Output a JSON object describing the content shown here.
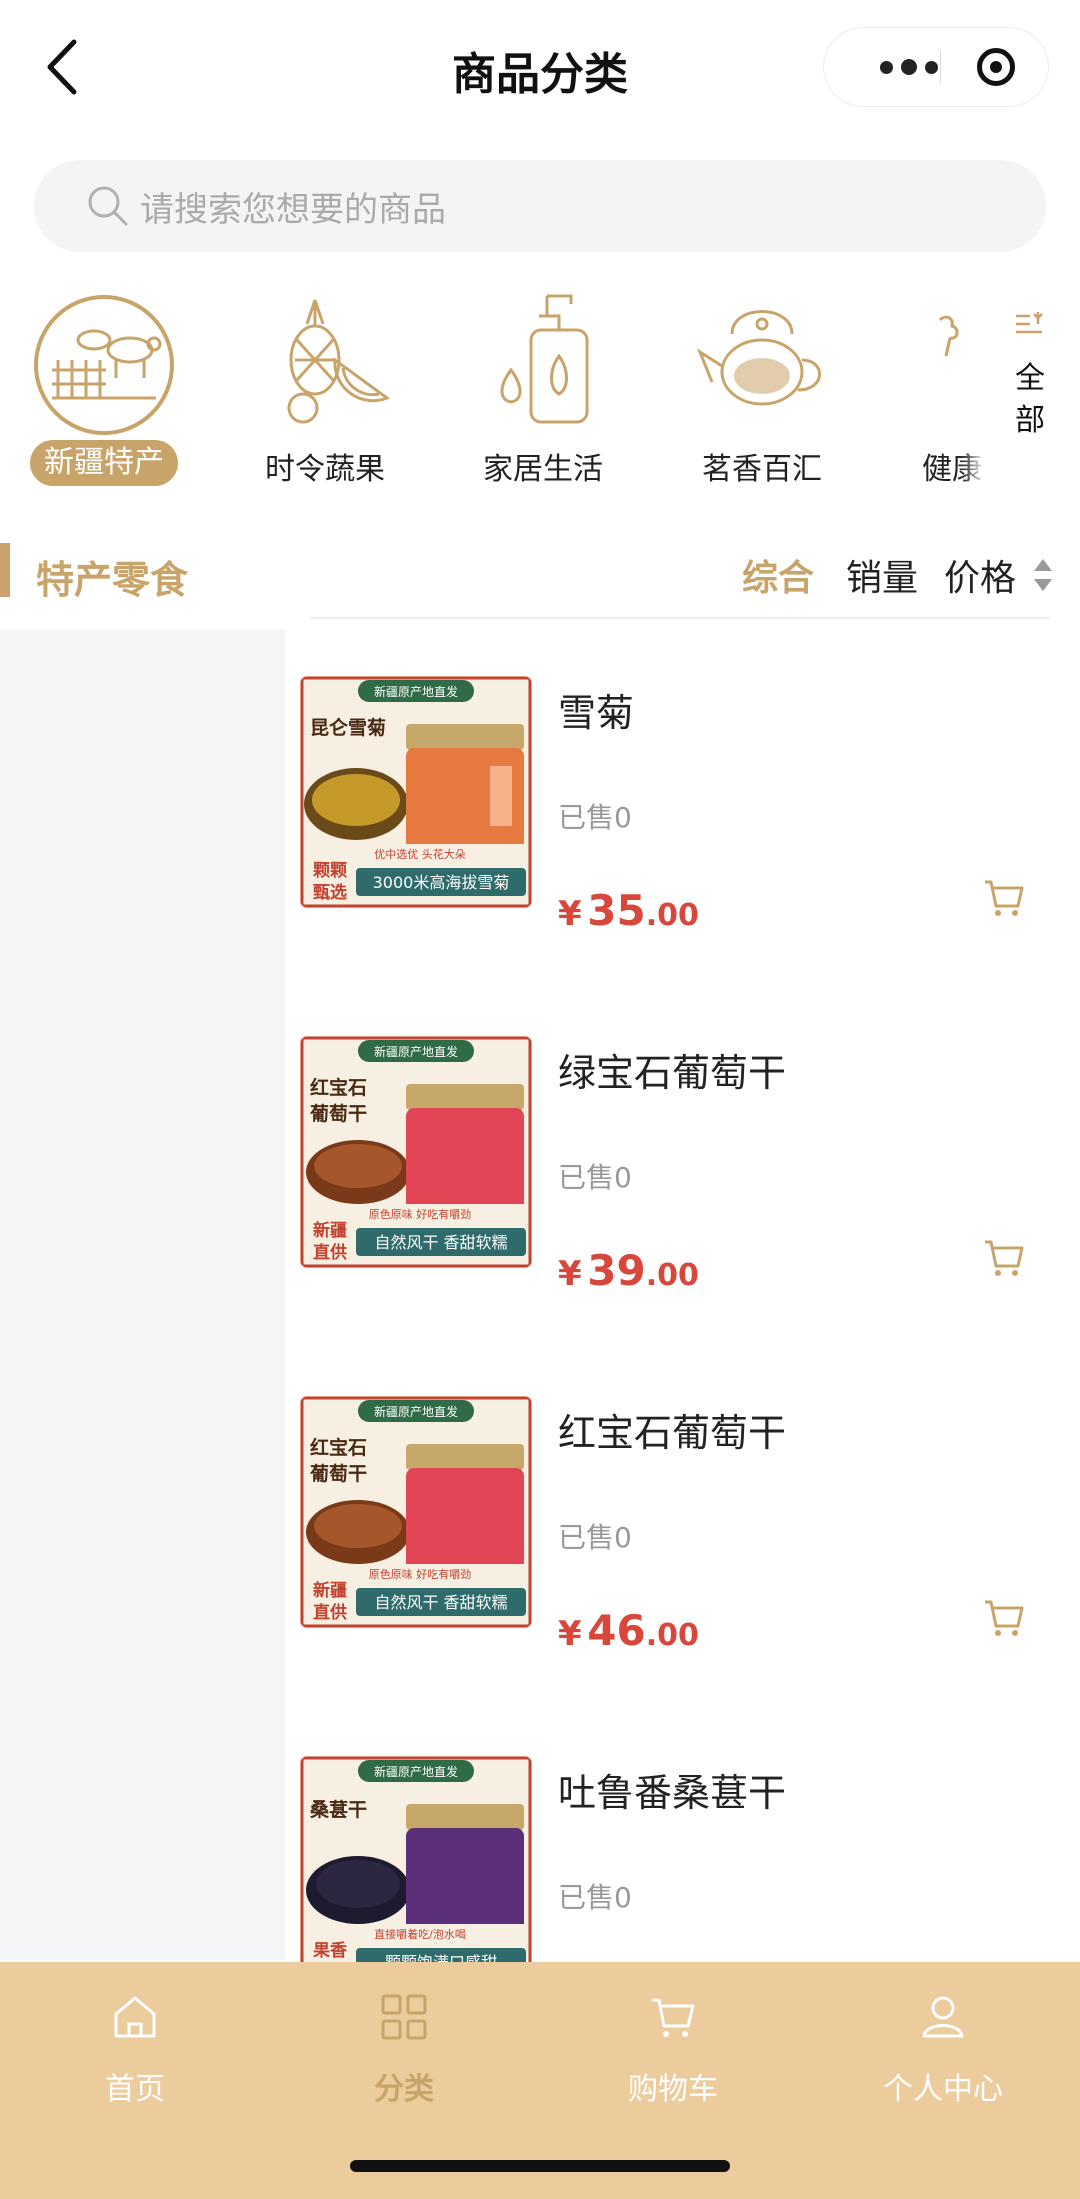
{
  "header": {
    "title": "商品分类"
  },
  "search": {
    "placeholder": "请搜索您想要的商品"
  },
  "categories": [
    {
      "label": "新疆特产",
      "icon": "farm-icon",
      "active": true
    },
    {
      "label": "时令蔬果",
      "icon": "fruit-icon",
      "active": false
    },
    {
      "label": "家居生活",
      "icon": "soap-bottle-icon",
      "active": false
    },
    {
      "label": "茗香百汇",
      "icon": "teapot-icon",
      "active": false
    },
    {
      "label": "健康",
      "icon": "health-icon",
      "active": false
    }
  ],
  "all_button": {
    "label": "全部"
  },
  "subcategory": {
    "title": "特产零食"
  },
  "sort": {
    "comprehensive": "综合",
    "sales": "销量",
    "price": "价格"
  },
  "products": [
    {
      "name": "雪菊",
      "sold": "已售0",
      "currency": "¥",
      "price_int": "35",
      "price_dec": ".00",
      "image": {
        "badge": "新疆原产地直发",
        "label": "昆仑雪菊",
        "corner": "颗颗甄选",
        "tagline": "3000米高海拔雪菊",
        "small": "优中选优 头花大朵"
      }
    },
    {
      "name": "绿宝石葡萄干",
      "sold": "已售0",
      "currency": "¥",
      "price_int": "39",
      "price_dec": ".00",
      "image": {
        "badge": "新疆原产地直发",
        "label": "红宝石葡萄干",
        "corner": "新疆直供",
        "tagline": "自然风干 香甜软糯",
        "small": "原色原味 好吃有嚼劲"
      }
    },
    {
      "name": "红宝石葡萄干",
      "sold": "已售0",
      "currency": "¥",
      "price_int": "46",
      "price_dec": ".00",
      "image": {
        "badge": "新疆原产地直发",
        "label": "红宝石葡萄干",
        "corner": "新疆直供",
        "tagline": "自然风干 香甜软糯",
        "small": "原色原味 好吃有嚼劲"
      }
    },
    {
      "name": "吐鲁番桑葚干",
      "sold": "已售0",
      "image": {
        "badge": "新疆原产地直发",
        "label": "桑葚干",
        "corner": "果香",
        "tagline": "颗颗饱满口感甜",
        "small": "直接嚼着吃/泡水喝"
      }
    }
  ],
  "tabbar": [
    {
      "label": "首页",
      "icon": "home-icon",
      "active": false
    },
    {
      "label": "分类",
      "icon": "grid-icon",
      "active": true
    },
    {
      "label": "购物车",
      "icon": "cart-icon",
      "active": false
    },
    {
      "label": "个人中心",
      "icon": "user-icon",
      "active": false
    }
  ],
  "colors": {
    "accent": "#c9a46a",
    "price": "#d8473b",
    "tabbar": "#eccb9c",
    "sidebar": "#f4f5f7"
  }
}
